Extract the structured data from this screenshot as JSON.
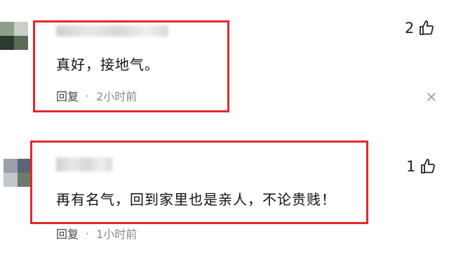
{
  "comments": [
    {
      "text": "真好，接地气。",
      "reply_label": "回复",
      "separator": "·",
      "time": "2小时前",
      "likes": "2",
      "avatar_colors": [
        "#8fa08a",
        "#c9cec7",
        "#2f3a30",
        "#5b6b58"
      ]
    },
    {
      "text": "再有名气，回到家里也是亲人，不论贵贱！",
      "reply_label": "回复",
      "separator": "·",
      "time": "1小时前",
      "likes": "1",
      "avatar_colors": [
        "#9aa0b0",
        "#5b6478",
        "#c2c7cc",
        "#6f7a6a"
      ]
    }
  ],
  "icons": {
    "like": "thumbs-up-outline",
    "dismiss": "close-x"
  },
  "colors": {
    "highlight_box": "#e02a2a"
  }
}
